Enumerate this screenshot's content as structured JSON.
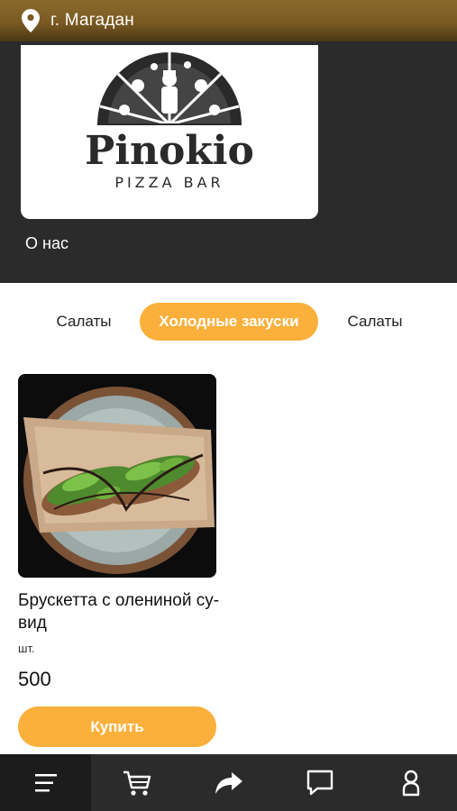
{
  "header": {
    "city": "г. Магадан",
    "location_icon": "map-pin-icon"
  },
  "hero": {
    "brand_name": "Pinokio",
    "brand_subtitle": "PIZZA BAR",
    "about_label": "О нас"
  },
  "category_tabs": [
    {
      "label": "Салаты",
      "active": false
    },
    {
      "label": "Холодные закуски",
      "active": true
    },
    {
      "label": "Салаты",
      "active": false
    }
  ],
  "product": {
    "name": "Брускетта с олениной су-вид",
    "unit": "шт.",
    "price": "500",
    "buy_label": "Купить"
  },
  "bottom_nav": [
    {
      "icon": "menu-icon",
      "active": true
    },
    {
      "icon": "cart-icon",
      "active": false
    },
    {
      "icon": "share-icon",
      "active": false
    },
    {
      "icon": "chat-icon",
      "active": false
    },
    {
      "icon": "profile-icon",
      "active": false
    }
  ],
  "colors": {
    "accent": "#fbb03b",
    "dark": "#2b2b2b",
    "header_gold": "#7a5a22"
  }
}
